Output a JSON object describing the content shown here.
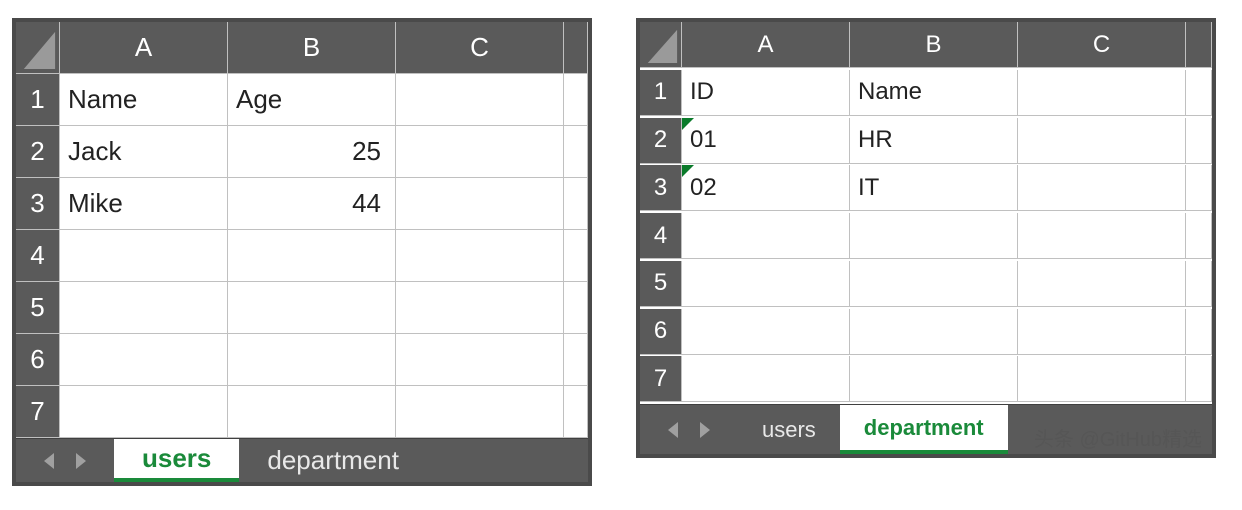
{
  "left": {
    "columns": [
      "A",
      "B",
      "C"
    ],
    "row_labels": [
      "1",
      "2",
      "3",
      "4",
      "5",
      "6",
      "7"
    ],
    "cells": {
      "A1": "Name",
      "B1": "Age",
      "A2": "Jack",
      "B2": "25",
      "A3": "Mike",
      "B3": "44"
    },
    "tabs": {
      "users": "users",
      "department": "department",
      "active": "users"
    }
  },
  "right": {
    "columns": [
      "A",
      "B",
      "C"
    ],
    "row_labels": [
      "1",
      "2",
      "3",
      "4",
      "5",
      "6",
      "7"
    ],
    "cells": {
      "A1": "ID",
      "B1": "Name",
      "A2": "01",
      "B2": "HR",
      "A3": "02",
      "B3": "IT"
    },
    "tabs": {
      "users": "users",
      "department": "department",
      "active": "department"
    }
  },
  "watermark": "头条 @GitHub精选"
}
